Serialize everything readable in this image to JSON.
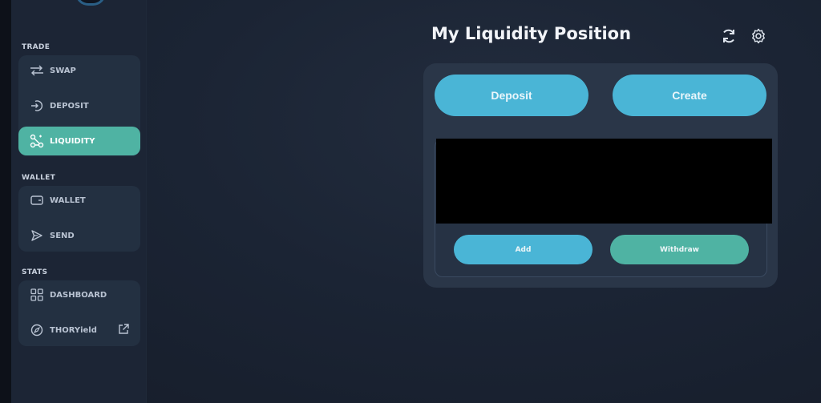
{
  "sidebar": {
    "sections": {
      "trade": "TRADE",
      "wallet": "WALLET",
      "stats": "STATS"
    },
    "items": {
      "swap": "SWAP",
      "deposit": "DEPOSIT",
      "liquidity": "LIQUIDITY",
      "wallet": "WALLET",
      "send": "SEND",
      "dashboard": "DASHBOARD",
      "thoryield": "THORYield"
    },
    "active_item": "LIQUIDITY"
  },
  "header": {
    "title": "My Liquidity Position",
    "icons": [
      "refresh-icon",
      "settings-icon"
    ]
  },
  "card": {
    "deposit_label": "Deposit",
    "create_label": "Create",
    "add_label": "Add",
    "withdraw_label": "Withdraw"
  },
  "colors": {
    "accent_blue": "#4ab5d6",
    "accent_teal": "#4fb3a3",
    "background": "#1b2434"
  }
}
